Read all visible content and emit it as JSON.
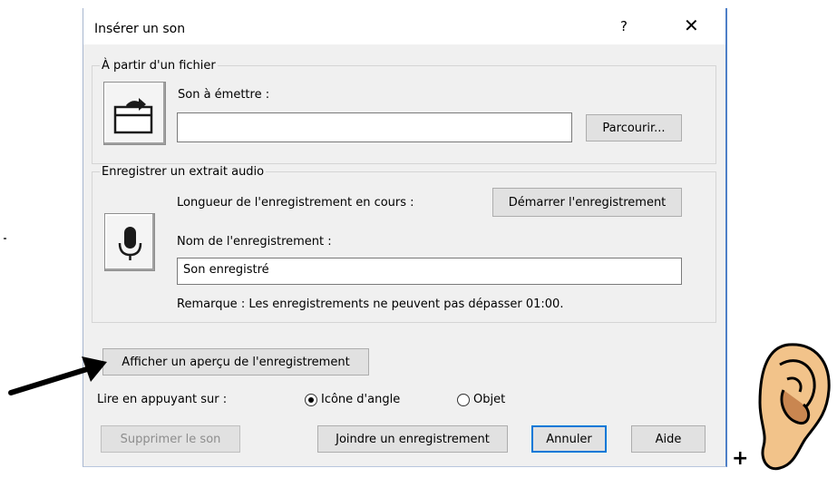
{
  "dialog": {
    "title": "Insérer un son",
    "help_label": "?",
    "close_label": "✕"
  },
  "file_group": {
    "legend": "À partir d'un fichier",
    "sound_label": "Son à émettre :",
    "sound_value": "",
    "browse_label": "Parcourir..."
  },
  "record_group": {
    "legend": "Enregistrer un extrait audio",
    "length_label": "Longueur de l'enregistrement en cours :",
    "start_label": "Démarrer l'enregistrement",
    "name_label": "Nom de l'enregistrement :",
    "name_value": "Son enregistré",
    "note": "Remarque : Les enregistrements ne peuvent pas dépasser 01:00."
  },
  "preview_label": "Afficher un aperçu de l'enregistrement",
  "play_on": {
    "label": "Lire en appuyant sur :",
    "options": [
      {
        "label": "Icône d'angle",
        "selected": true
      },
      {
        "label": "Objet",
        "selected": false
      }
    ]
  },
  "footer": {
    "delete_label": "Supprimer le son",
    "attach_label": "Joindre un enregistrement",
    "cancel_label": "Annuler",
    "help_label": "Aide"
  },
  "annotation": {
    "plus": "+"
  },
  "colors": {
    "accent": "#0078d7",
    "dialog_bg": "#f0f0f0",
    "skin": "#f2c38a",
    "skin_dark": "#c98650"
  }
}
